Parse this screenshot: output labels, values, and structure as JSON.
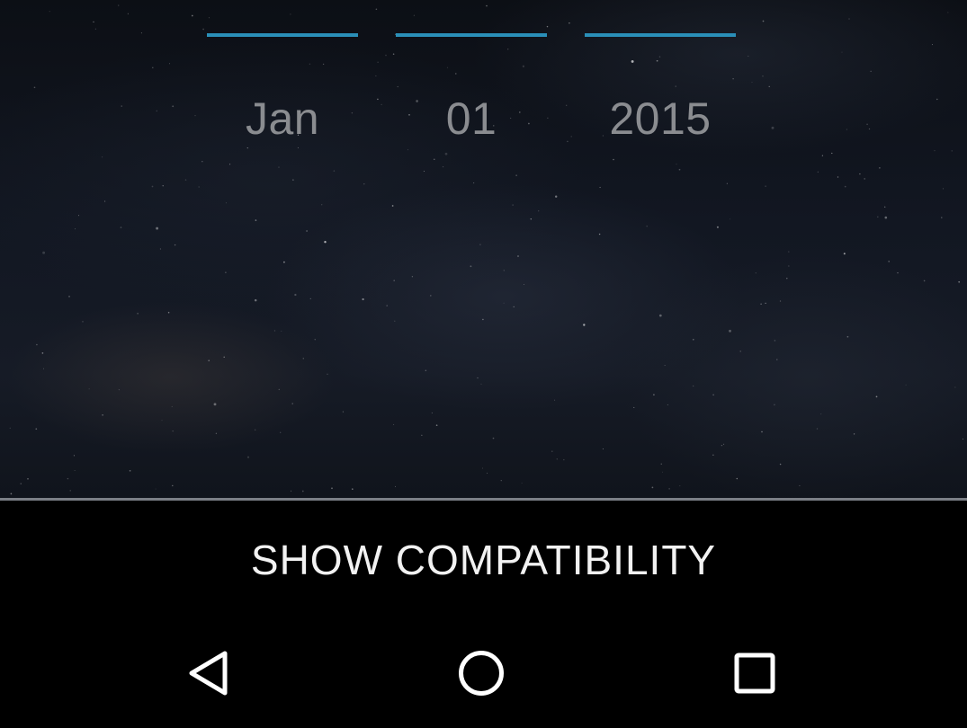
{
  "date_picker": {
    "month": "Jan",
    "day": "01",
    "year": "2015",
    "accent_color": "#2a8fb8"
  },
  "action_bar": {
    "show_compatibility_label": "SHOW COMPATIBILITY"
  },
  "nav_bar": {
    "back_icon": "back-triangle-icon",
    "home_icon": "home-circle-icon",
    "recents_icon": "recents-square-icon"
  }
}
